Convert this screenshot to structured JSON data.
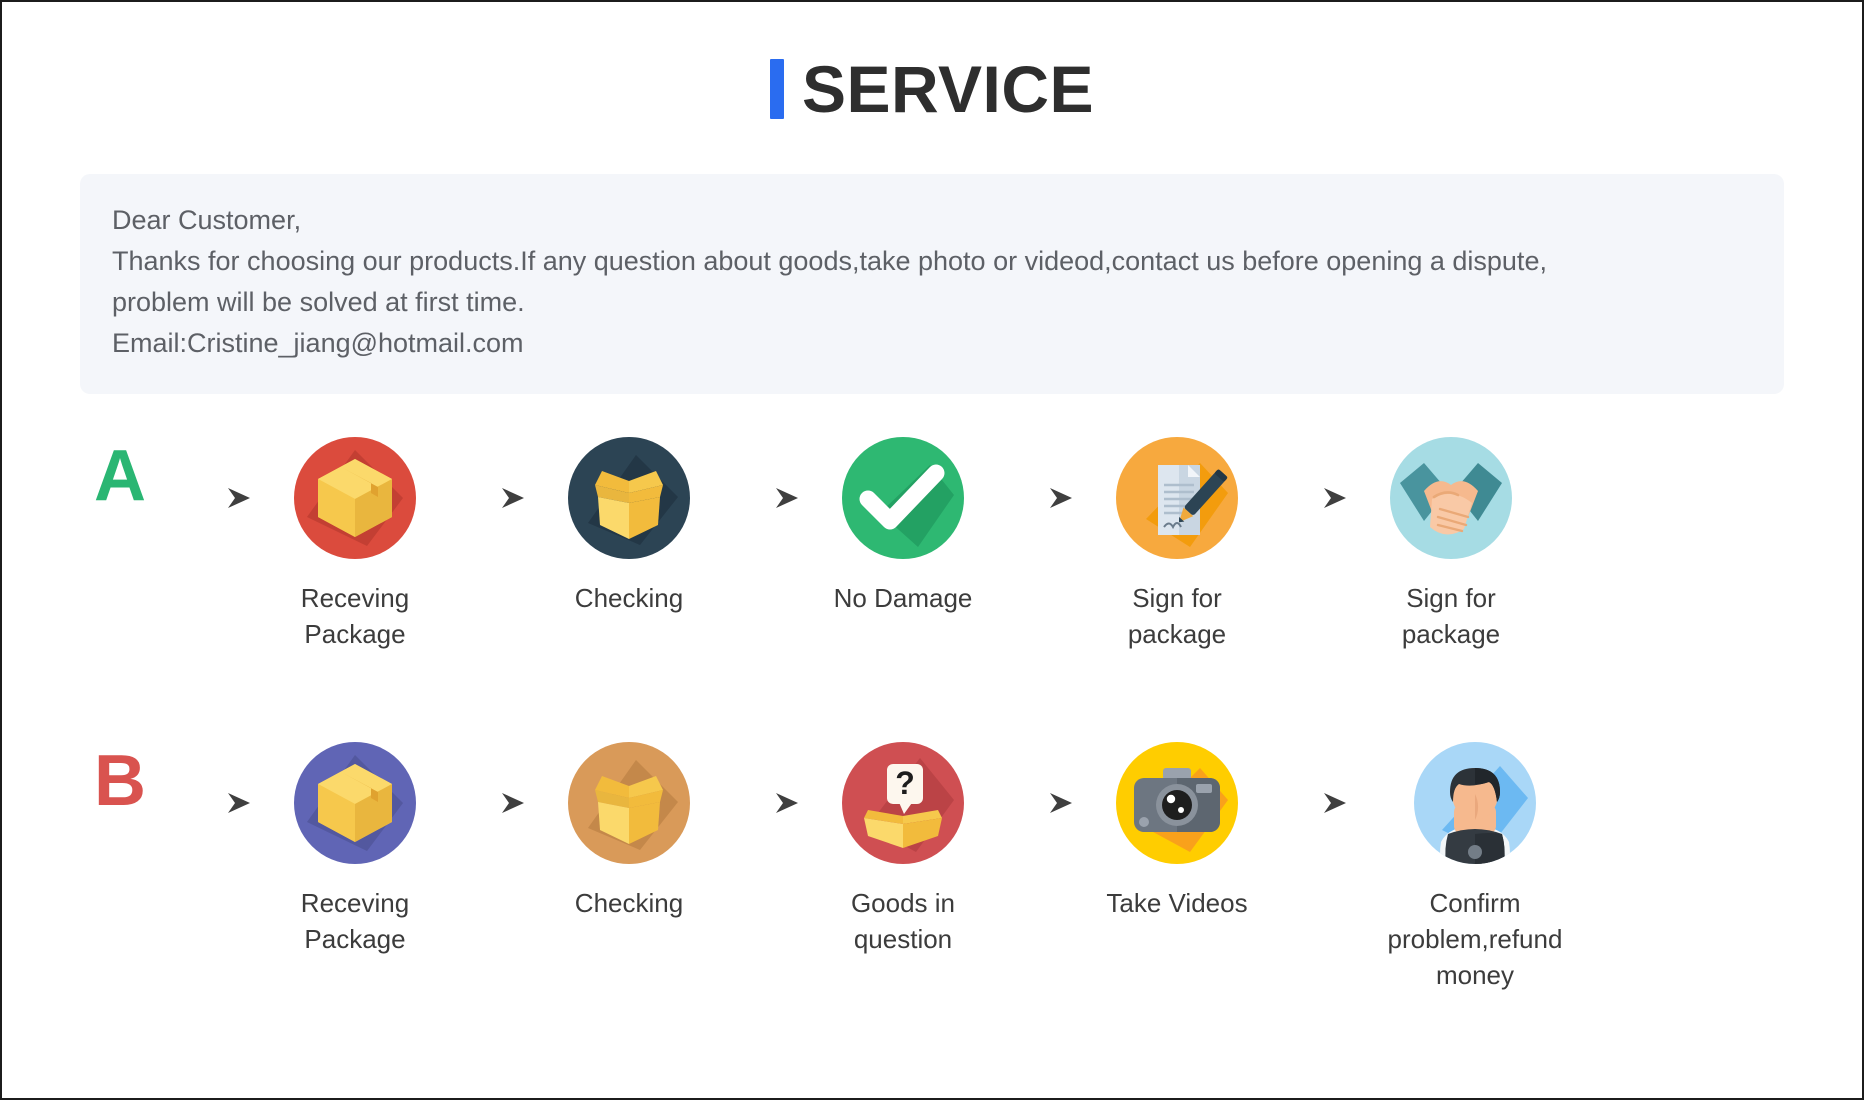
{
  "header": {
    "title": "SERVICE",
    "accent_color": "#2a6cf0",
    "title_color": "#2e2e2e"
  },
  "notice": {
    "background_color": "#f4f6fa",
    "lines": [
      "Dear Customer,",
      "Thanks for choosing our products.If any question about goods,take photo or videod,contact us before opening a dispute,",
      "problem will be solved at first time.",
      "Email:Cristine_jiang@hotmail.com"
    ]
  },
  "flows": [
    {
      "letter": "A",
      "letter_color": "#2ab673",
      "steps": [
        {
          "label": "Receving Package",
          "icon": "closed-box-icon",
          "circle_color": "#db4b3d",
          "shadow_color": "#c33f33"
        },
        {
          "label": "Checking",
          "icon": "open-box-icon",
          "circle_color": "#2c4454",
          "shadow_color": "#233746"
        },
        {
          "label": "No Damage",
          "icon": "checkmark-icon",
          "circle_color": "#2eb872",
          "shadow_color": "#23a163"
        },
        {
          "label": "Sign for package",
          "icon": "document-pen-icon",
          "circle_color": "#f7a93e",
          "shadow_color": "#f39c0d"
        },
        {
          "label": "Sign for package",
          "icon": "handshake-icon",
          "circle_color": "#a6dce4",
          "shadow_color": "#93d2dd"
        }
      ]
    },
    {
      "letter": "B",
      "letter_color": "#d9534f",
      "steps": [
        {
          "label": "Receving Package",
          "icon": "closed-box-icon",
          "circle_color": "#6065b5",
          "shadow_color": "#53589f"
        },
        {
          "label": "Checking",
          "icon": "open-box-icon",
          "circle_color": "#d99a59",
          "shadow_color": "#c4884a"
        },
        {
          "label": "Goods in question",
          "icon": "question-box-icon",
          "circle_color": "#cf4f52",
          "shadow_color": "#bb4346"
        },
        {
          "label": "Take Videos",
          "icon": "camera-icon",
          "circle_color": "#ffcd00",
          "shadow_color": "#f9a11b"
        },
        {
          "label": "Confirm problem,refund money",
          "icon": "support-agent-icon",
          "circle_color": "#a9d7f7",
          "shadow_color": "#6cb9f2"
        }
      ]
    }
  ],
  "arrow": {
    "icon": "arrow-right-icon",
    "color": "#3f3f3f"
  }
}
